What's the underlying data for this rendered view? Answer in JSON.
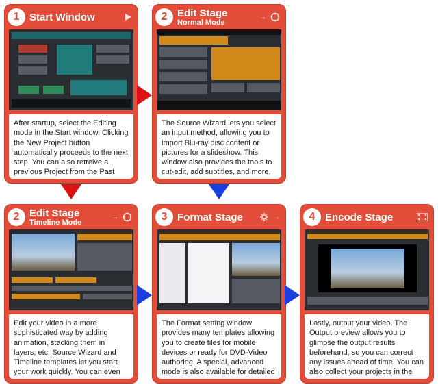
{
  "cards": [
    {
      "num": "1",
      "title": "Start Window",
      "subtitle": "",
      "desc": "After startup, select the Editing mode in the Start window. Clicking the New Project button automatically proceeds to the next step. You can also retreive a previous Project from the Past projects list."
    },
    {
      "num": "2",
      "title": "Edit Stage",
      "subtitle": "Normal Mode",
      "desc": "The Source Wizard lets you select an input method, allowing you to import Blu-ray disc content or pictures for a slideshow. This window also provides the tools to cut-edit, add subtitles, and more."
    },
    {
      "num": "2",
      "title": "Edit Stage",
      "subtitle": "Timeline Mode",
      "desc": "Edit your video in a more sophisticated way by adding animation, stacking them in layers, etc. Source Wizard and Timeline templates let you start your work quickly. You can even edit by drag'n drop."
    },
    {
      "num": "3",
      "title": "Format Stage",
      "subtitle": "",
      "desc": "The Format setting window provides many templates allowing you to create files for mobile devices or ready for DVD-Video authoring. A special, advanced mode is also available for detailed settings."
    },
    {
      "num": "4",
      "title": "Encode Stage",
      "subtitle": "",
      "desc": "Lastly, output your video. The Output preview allows you to glimpse the output results beforehand, so you can correct any issues ahead of time. You can also collect your projects in the Batch encode tool and encode them."
    }
  ]
}
